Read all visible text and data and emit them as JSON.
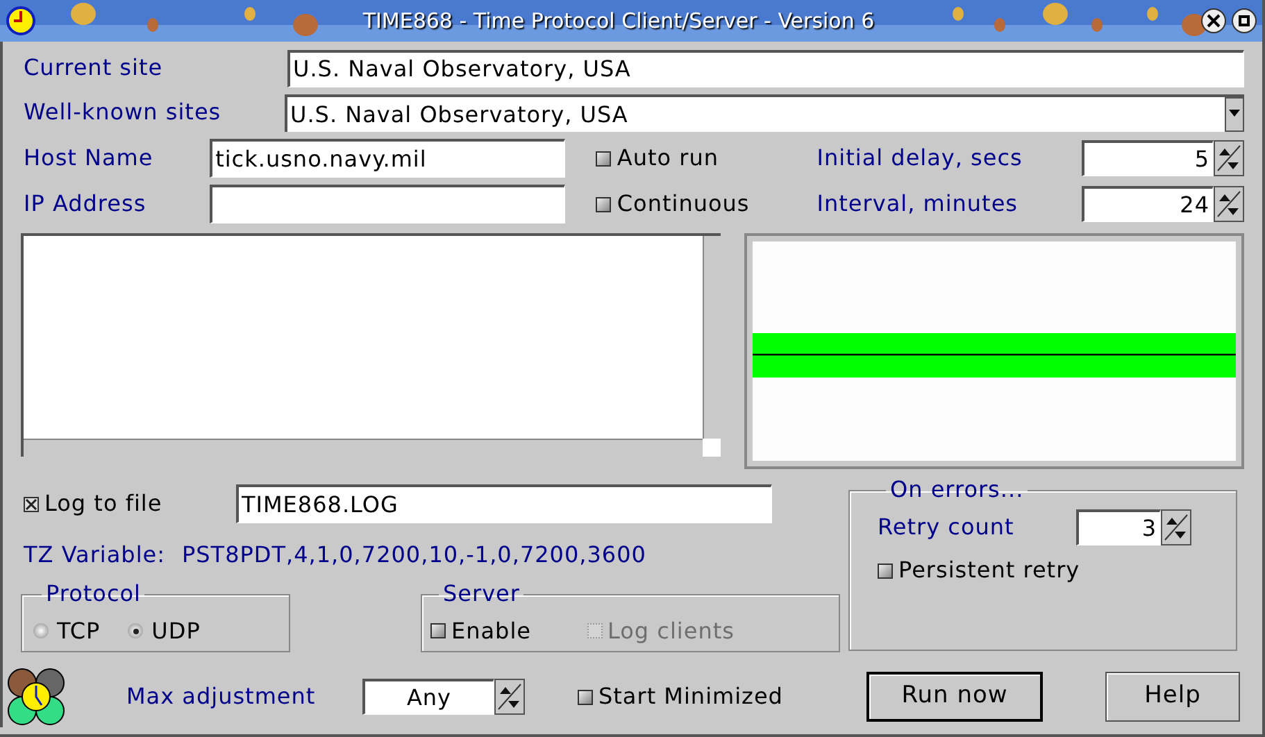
{
  "window": {
    "title": "TIME868 - Time Protocol Client/Server - Version 6"
  },
  "current_site": {
    "label": "Current site",
    "value": "U.S. Naval Observatory, USA"
  },
  "well_known_sites": {
    "label": "Well-known sites",
    "value": "U.S. Naval Observatory, USA"
  },
  "host_name": {
    "label": "Host Name",
    "value": "tick.usno.navy.mil"
  },
  "ip_address": {
    "label": "IP Address"
  },
  "options": [
    {
      "label": "Auto run",
      "checked": false
    },
    {
      "label": "Continuous",
      "checked": false
    }
  ],
  "initial_delay": {
    "label": "Initial delay, secs",
    "value": "5"
  },
  "interval": {
    "label": "Interval, minutes",
    "value": "24"
  },
  "log_to_file": {
    "label": "Log to file",
    "checked": true,
    "value": "TIME868.LOG"
  },
  "tz_variable": {
    "label": "TZ Variable:",
    "value": "PST8PDT,4,1,0,7200,10,-1,0,7200,3600"
  },
  "protocol": {
    "title": "Protocol",
    "options": [
      {
        "label": "TCP",
        "selected": false
      },
      {
        "label": "UDP",
        "selected": true
      }
    ]
  },
  "server": {
    "title": "Server",
    "options": [
      {
        "label": "Enable",
        "checked": false,
        "disabled": false
      },
      {
        "label": "Log clients",
        "checked": false,
        "disabled": true
      }
    ]
  },
  "on_errors": {
    "title": "On errors...",
    "retry_count": {
      "label": "Retry count",
      "value": "3"
    },
    "persistent_retry": {
      "label": "Persistent retry",
      "checked": false
    }
  },
  "max_adjustment": {
    "label": "Max adjustment",
    "value": "Any"
  },
  "start_minimized": {
    "label": "Start Minimized",
    "checked": false
  },
  "buttons": [
    {
      "label": "Run now",
      "default": true
    },
    {
      "label": "Help",
      "default": false
    }
  ]
}
